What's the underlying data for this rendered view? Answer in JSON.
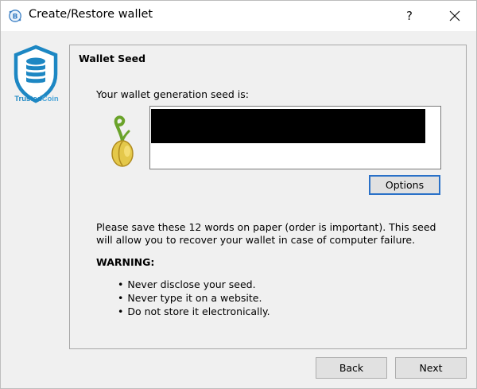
{
  "window": {
    "title": "Create/Restore wallet",
    "help_label": "?",
    "icons": {
      "app": "electrum-icon",
      "close": "close-icon",
      "help": "help-icon"
    }
  },
  "logo": {
    "name": "trustedcoin-logo",
    "label_part1": "Trusted",
    "label_part2": "Coin",
    "colors": {
      "primary": "#1d87c3",
      "secondary": "#4aa4d8"
    }
  },
  "page": {
    "title": "Wallet Seed",
    "seed_label": "Your wallet generation seed is:",
    "seed_value": "[redacted]",
    "options_button": "Options",
    "info_text": "Please save these 12 words on paper (order is important). This seed will allow you to recover your wallet in case of computer failure.",
    "warning_label": "WARNING:",
    "warnings": [
      "Never disclose your seed.",
      "Never type it on a website.",
      "Do not store it electronically."
    ]
  },
  "footer": {
    "back_button": "Back",
    "next_button": "Next"
  },
  "colors": {
    "accent": "#2a71c8",
    "window_bg": "#f0f0f0",
    "button_bg": "#e1e1e1"
  }
}
